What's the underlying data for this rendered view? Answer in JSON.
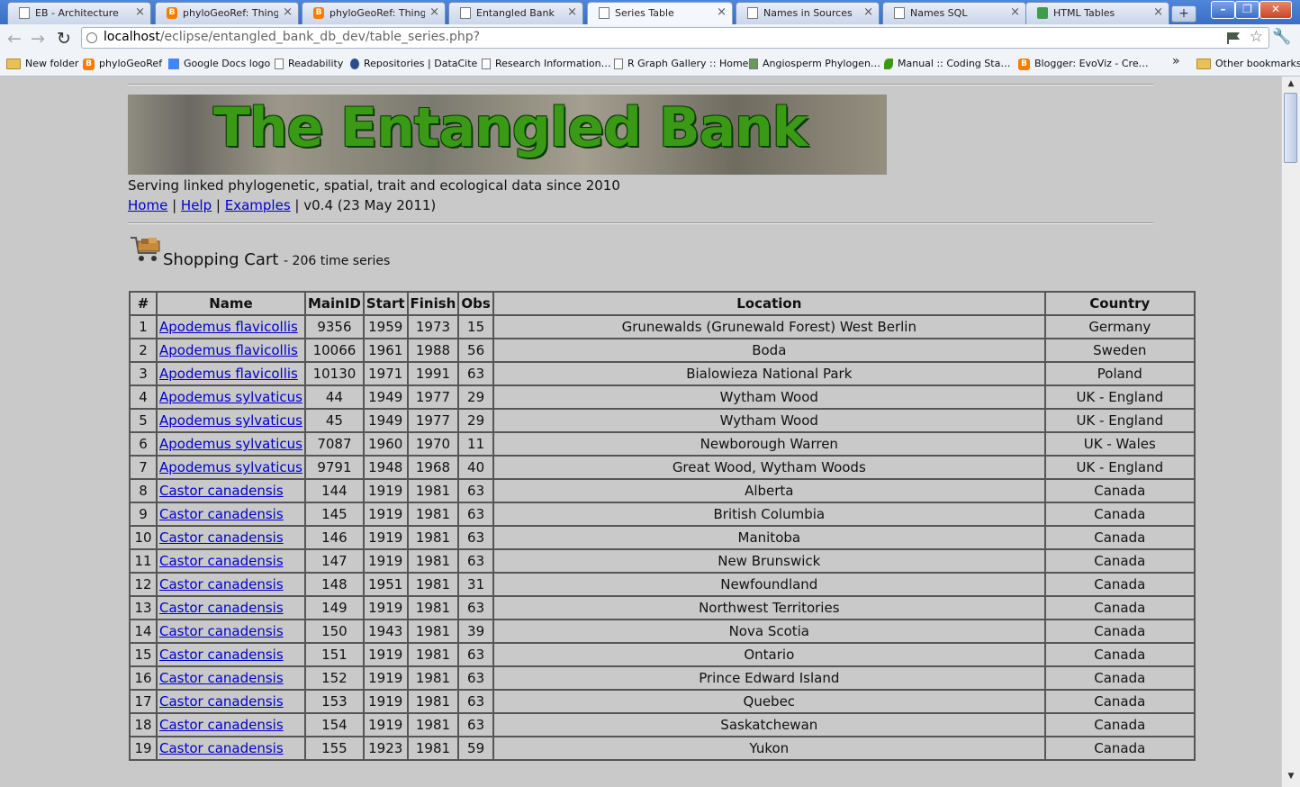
{
  "browser": {
    "tabs": [
      {
        "label": "EB - Architecture",
        "icon": "page-icon",
        "left": 0
      },
      {
        "label": "phyloGeoRef: Thing…",
        "icon": "blogger-icon"
      },
      {
        "label": "phyloGeoRef: Thing…",
        "icon": "blogger-icon"
      },
      {
        "label": "Entangled Bank",
        "icon": "page-icon"
      },
      {
        "label": "Series Table",
        "icon": "page-icon"
      },
      {
        "label": "Names in Sources",
        "icon": "page-icon"
      },
      {
        "label": "Names SQL",
        "icon": "page-icon"
      },
      {
        "label": "HTML Tables",
        "icon": "grid-icon"
      }
    ],
    "url_host": "localhost",
    "url_path": "/eclipse/entangled_bank_db_dev/table_series.php?",
    "bookmarks": [
      "New folder",
      "phyloGeoRef",
      "Google Docs logo",
      "Readability",
      "Repositories | DataCite",
      "Research Information…",
      "R Graph Gallery :: Home",
      "Angiosperm Phylogen…",
      "Manual :: Coding Sta…",
      "Blogger: EvoViz - Cre…"
    ],
    "other_bookmarks": "Other bookmarks",
    "chevron": "»"
  },
  "site": {
    "banner_title": "The Entangled Bank",
    "tagline": "Serving linked phylogenetic, spatial, trait and ecological data since 2010",
    "nav_home": "Home",
    "nav_help": "Help",
    "nav_examples": "Examples",
    "version": "v0.4 (23 May 2011)",
    "sep": "|"
  },
  "cart": {
    "title": "Shopping Cart",
    "subtitle": "- 206 time series"
  },
  "table": {
    "headers": [
      "#",
      "Name",
      "MainID",
      "Start",
      "Finish",
      "Obs",
      "Location",
      "Country"
    ],
    "rows": [
      [
        "1",
        "Apodemus flavicollis",
        "9356",
        "1959",
        "1973",
        "15",
        "Grunewalds (Grunewald Forest) West Berlin",
        "Germany"
      ],
      [
        "2",
        "Apodemus flavicollis",
        "10066",
        "1961",
        "1988",
        "56",
        "Boda",
        "Sweden"
      ],
      [
        "3",
        "Apodemus flavicollis",
        "10130",
        "1971",
        "1991",
        "63",
        "Bialowieza National Park",
        "Poland"
      ],
      [
        "4",
        "Apodemus sylvaticus",
        "44",
        "1949",
        "1977",
        "29",
        "Wytham Wood",
        "UK - England"
      ],
      [
        "5",
        "Apodemus sylvaticus",
        "45",
        "1949",
        "1977",
        "29",
        "Wytham Wood",
        "UK - England"
      ],
      [
        "6",
        "Apodemus sylvaticus",
        "7087",
        "1960",
        "1970",
        "11",
        "Newborough Warren",
        "UK - Wales"
      ],
      [
        "7",
        "Apodemus sylvaticus",
        "9791",
        "1948",
        "1968",
        "40",
        "Great Wood, Wytham Woods",
        "UK - England"
      ],
      [
        "8",
        "Castor canadensis",
        "144",
        "1919",
        "1981",
        "63",
        "Alberta",
        "Canada"
      ],
      [
        "9",
        "Castor canadensis",
        "145",
        "1919",
        "1981",
        "63",
        "British Columbia",
        "Canada"
      ],
      [
        "10",
        "Castor canadensis",
        "146",
        "1919",
        "1981",
        "63",
        "Manitoba",
        "Canada"
      ],
      [
        "11",
        "Castor canadensis",
        "147",
        "1919",
        "1981",
        "63",
        "New Brunswick",
        "Canada"
      ],
      [
        "12",
        "Castor canadensis",
        "148",
        "1951",
        "1981",
        "31",
        "Newfoundland",
        "Canada"
      ],
      [
        "13",
        "Castor canadensis",
        "149",
        "1919",
        "1981",
        "63",
        "Northwest Territories",
        "Canada"
      ],
      [
        "14",
        "Castor canadensis",
        "150",
        "1943",
        "1981",
        "39",
        "Nova Scotia",
        "Canada"
      ],
      [
        "15",
        "Castor canadensis",
        "151",
        "1919",
        "1981",
        "63",
        "Ontario",
        "Canada"
      ],
      [
        "16",
        "Castor canadensis",
        "152",
        "1919",
        "1981",
        "63",
        "Prince Edward Island",
        "Canada"
      ],
      [
        "17",
        "Castor canadensis",
        "153",
        "1919",
        "1981",
        "63",
        "Quebec",
        "Canada"
      ],
      [
        "18",
        "Castor canadensis",
        "154",
        "1919",
        "1981",
        "63",
        "Saskatchewan",
        "Canada"
      ],
      [
        "19",
        "Castor canadensis",
        "155",
        "1923",
        "1981",
        "59",
        "Yukon",
        "Canada"
      ]
    ]
  },
  "colors": {
    "page_bg": "#c9c9c9",
    "link": "#0000cc",
    "banner_green": "#3a9a16"
  }
}
